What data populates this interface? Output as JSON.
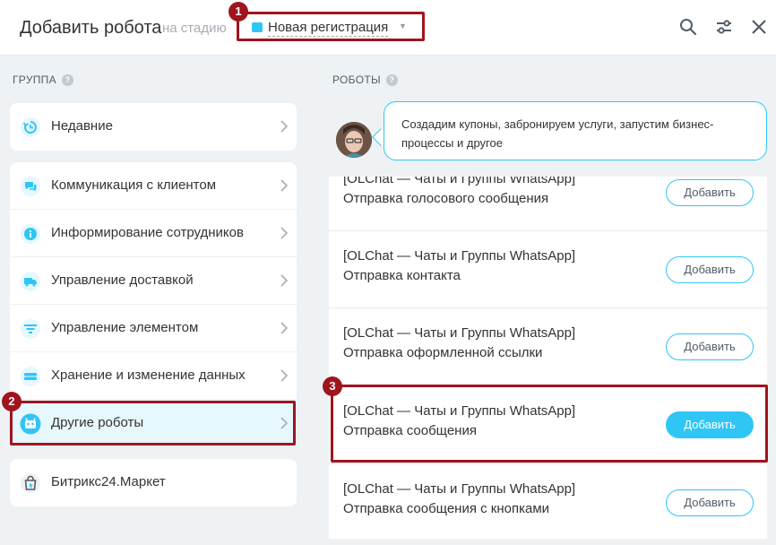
{
  "header": {
    "title": "Добавить робота",
    "stage_label": "на стадию",
    "stage_value": "Новая регистрация",
    "stage_color": "#2fc6f6",
    "icons": [
      "search-icon",
      "filter-settings-icon",
      "close-icon"
    ]
  },
  "badges": {
    "one": "1",
    "two": "2",
    "three": "3"
  },
  "groups": {
    "label": "ГРУППА",
    "recent": {
      "label": "Недавние",
      "icon": "history-icon"
    },
    "items": [
      {
        "label": "Коммуникация с клиентом",
        "icon": "chat-icon"
      },
      {
        "label": "Информирование сотрудников",
        "icon": "info-icon"
      },
      {
        "label": "Управление доставкой",
        "icon": "truck-icon"
      },
      {
        "label": "Управление элементом",
        "icon": "filter-icon"
      },
      {
        "label": "Хранение и изменение данных",
        "icon": "storage-icon"
      },
      {
        "label": "Другие роботы",
        "icon": "robot-icon",
        "selected": true
      }
    ],
    "market": {
      "label": "Битрикс24.Маркет",
      "icon": "market-bag-icon"
    }
  },
  "robots": {
    "label": "РОБОТЫ",
    "hint": "Создадим купоны, забронируем услуги, запустим бизнес-процессы и другое",
    "add_label": "Добавить",
    "list": [
      {
        "line1": "[OLChat — Чаты и Группы WhatsApp]",
        "line2": "Отправка голосового сообщения"
      },
      {
        "line1": "[OLChat — Чаты и Группы WhatsApp]",
        "line2": "Отправка контакта"
      },
      {
        "line1": "[OLChat — Чаты и Группы WhatsApp]",
        "line2": "Отправка оформленной ссылки"
      },
      {
        "line1": "[OLChat — Чаты и Группы WhatsApp]",
        "line2": "Отправка сообщения",
        "active": true
      },
      {
        "line1": "[OLChat — Чаты и Группы WhatsApp]",
        "line2": "Отправка сообщения с кнопками"
      }
    ]
  }
}
